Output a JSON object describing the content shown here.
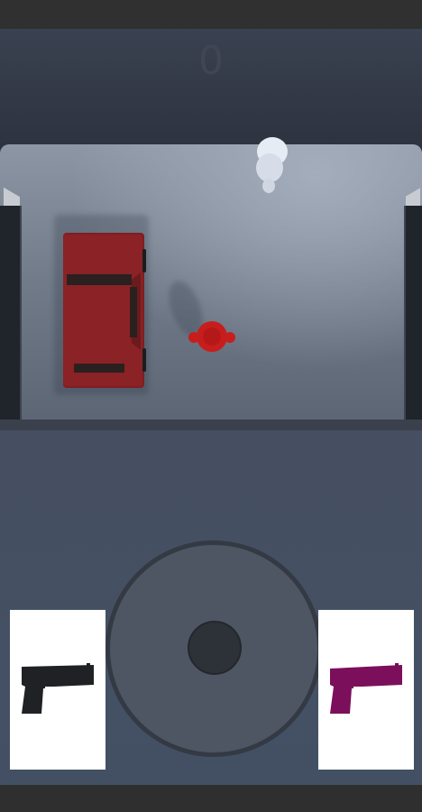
{
  "hud": {
    "score": "0"
  },
  "weapons": [
    {
      "name": "pistol-black",
      "icon": "pistol-icon",
      "color": "#1f2124"
    },
    {
      "name": "pistol-purple",
      "icon": "pistol-icon",
      "color": "#7b0f5c"
    }
  ],
  "scene": {
    "player_color": "#c81d1d",
    "enemy_color": "#e6ecf4",
    "car_color": "#7f1e22",
    "joystick_color": "#4e5664"
  }
}
